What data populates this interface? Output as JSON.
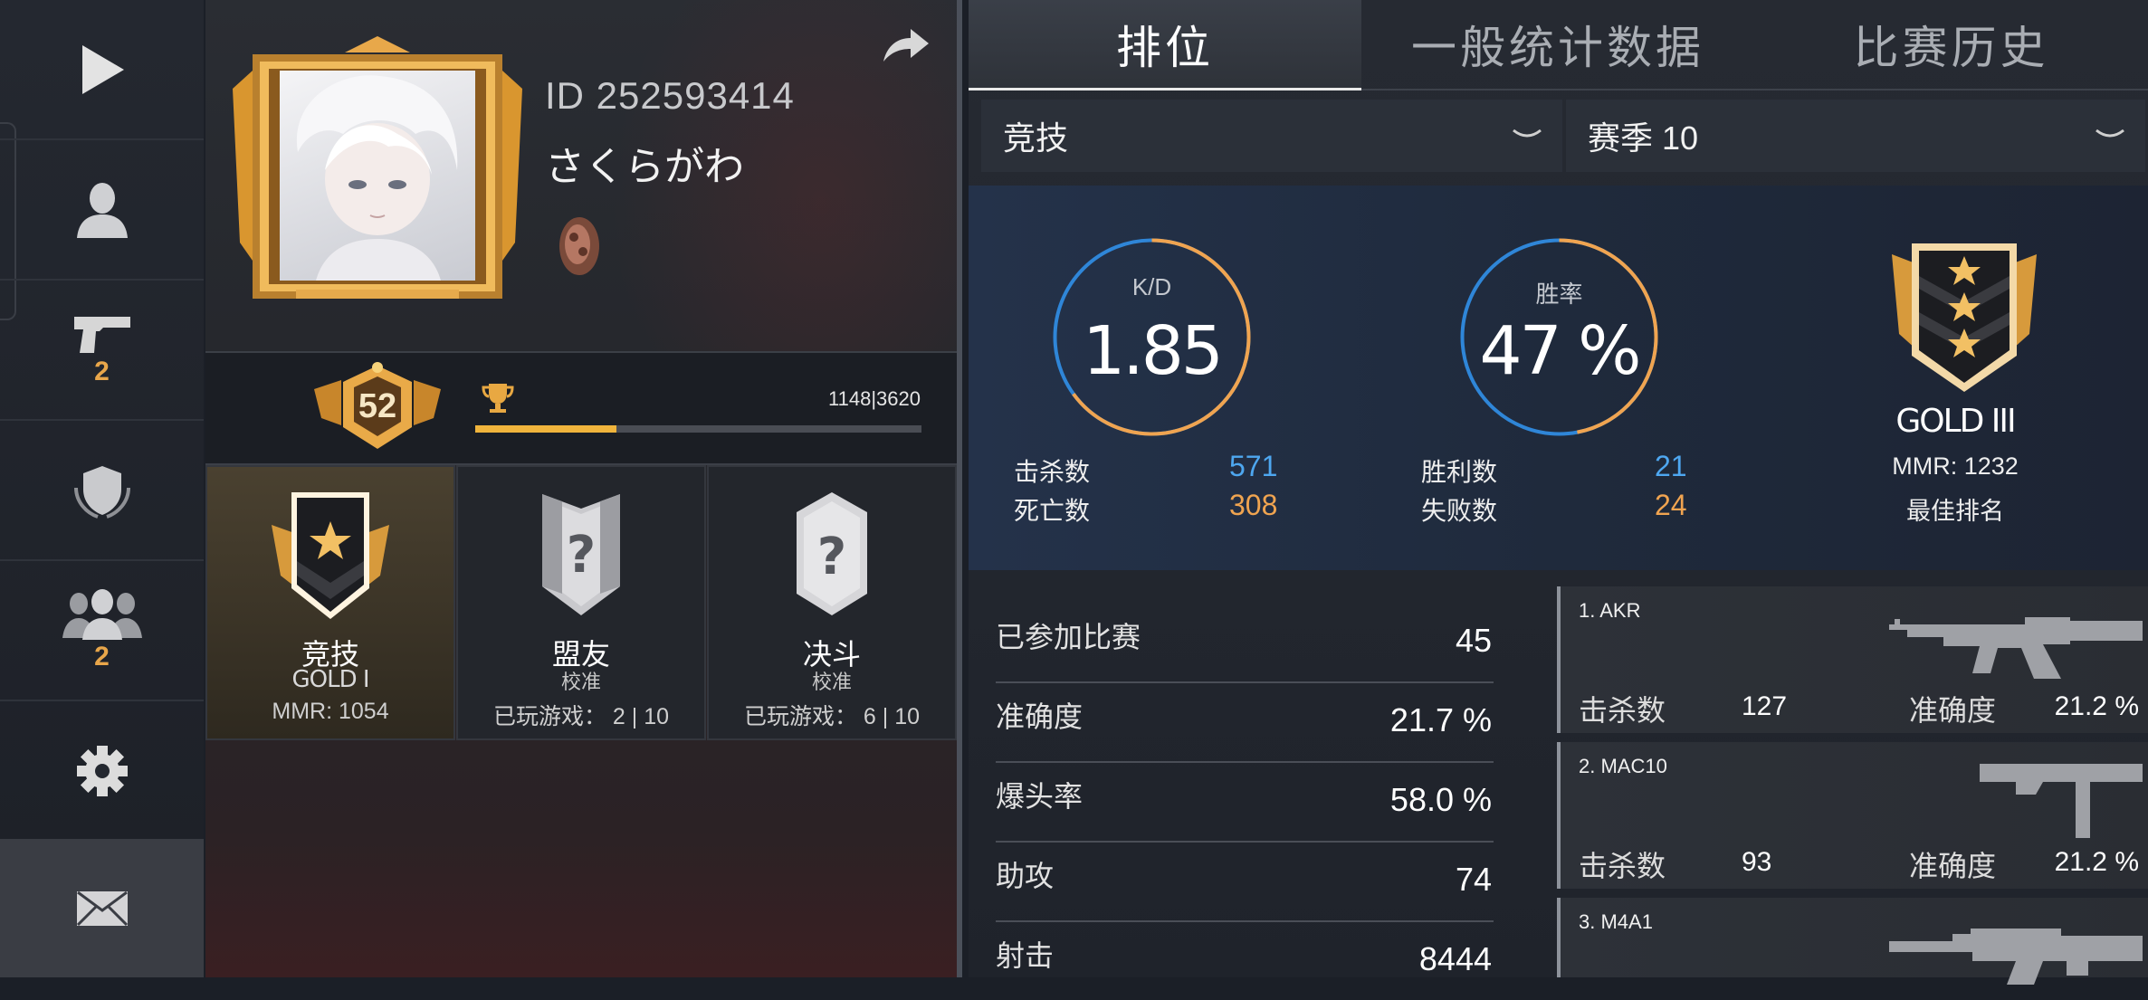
{
  "sidebar": {
    "weapons_badge": "2",
    "friends_badge": "2"
  },
  "profile": {
    "id": "ID 252593414",
    "name": "さくらがわ",
    "level": "52",
    "xp": "1148|3620",
    "xp_progress": 0.317
  },
  "modes": [
    {
      "title": "竞技",
      "sub": "GOLD I",
      "foot": "MMR: 1054"
    },
    {
      "title": "盟友",
      "sub": "校准",
      "foot": "已玩游戏： 2 | 10"
    },
    {
      "title": "决斗",
      "sub": "校准",
      "foot": "已玩游戏： 6 | 10"
    }
  ],
  "tabs": [
    "排位",
    "一般统计数据",
    "比赛历史"
  ],
  "filters": {
    "mode": "竞技",
    "season": "赛季 10"
  },
  "summary": {
    "kd_label": "K/D",
    "kd_value": "1.85",
    "kd_ratio": 0.65,
    "winrate_label": "胜率",
    "winrate_value": "47 %",
    "winrate": 0.47,
    "kills_label": "击杀数",
    "kills": "571",
    "deaths_label": "死亡数",
    "deaths": "308",
    "wins_label": "胜利数",
    "wins": "21",
    "losses_label": "失败数",
    "losses": "24",
    "rank_name": "GOLD III",
    "mmr": "MMR: 1232",
    "best_rank": "最佳排名"
  },
  "details": [
    {
      "label": "已参加比赛",
      "value": "45"
    },
    {
      "label": "准确度",
      "value": "21.7 %"
    },
    {
      "label": "爆头率",
      "value": "58.0 %"
    },
    {
      "label": "助攻",
      "value": "74"
    },
    {
      "label": "射击",
      "value": "8444"
    }
  ],
  "weapons": [
    {
      "name": "1. AKR",
      "kills_label": "击杀数",
      "kills": "127",
      "acc_label": "准确度",
      "acc": "21.2 %"
    },
    {
      "name": "2. MAC10",
      "kills_label": "击杀数",
      "kills": "93",
      "acc_label": "准确度",
      "acc": "21.2 %"
    },
    {
      "name": "3. M4A1"
    }
  ],
  "colors": {
    "accent_gold": "#f0b43c",
    "kd_blue": "#4ea7f0",
    "kd_orange": "#f0a450"
  }
}
